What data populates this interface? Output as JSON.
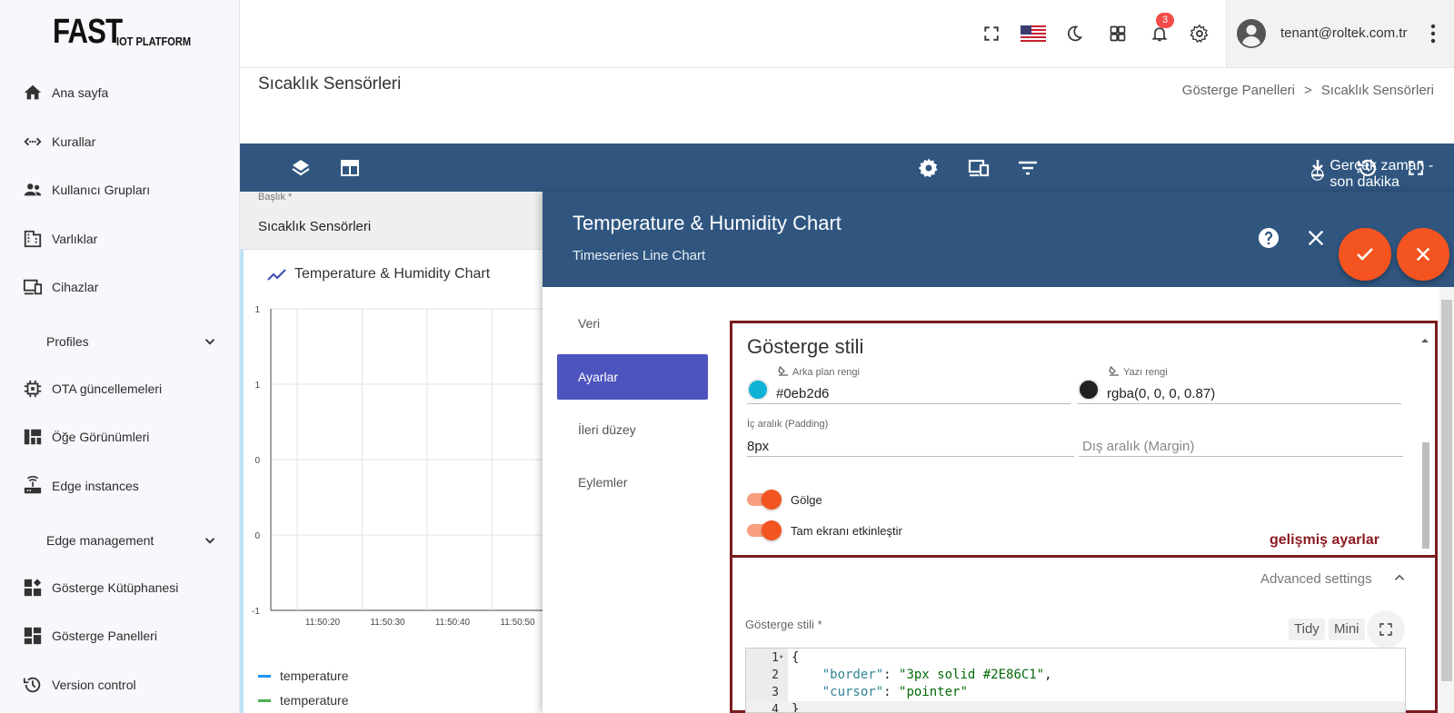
{
  "logo": {
    "main": "FAST",
    "sub": "IOT PLATFORM"
  },
  "sidebar": {
    "items": [
      {
        "label": "Ana sayfa",
        "icon": "home-icon"
      },
      {
        "label": "Kurallar",
        "icon": "rule-chain-icon"
      },
      {
        "label": "Kullanıcı Grupları",
        "icon": "users-icon"
      },
      {
        "label": "Varlıklar",
        "icon": "asset-icon"
      },
      {
        "label": "Cihazlar",
        "icon": "devices-icon"
      },
      {
        "label": "Profiles",
        "icon": "chevron-down-icon",
        "group": true
      },
      {
        "label": "OTA güncellemeleri",
        "icon": "chip-icon"
      },
      {
        "label": "Öğe Görünümleri",
        "icon": "widgets-icon"
      },
      {
        "label": "Edge instances",
        "icon": "router-icon"
      },
      {
        "label": "Edge management",
        "icon": "chevron-down-icon",
        "group": true
      },
      {
        "label": "Gösterge Kütüphanesi",
        "icon": "widget-library-icon"
      },
      {
        "label": "Gösterge Panelleri",
        "icon": "dashboard-icon"
      },
      {
        "label": "Version control",
        "icon": "history-icon"
      }
    ]
  },
  "topbar": {
    "notification_count": "3",
    "user_email": "tenant@roltek.com.tr"
  },
  "page": {
    "title": "Sıcaklık Sensörleri",
    "breadcrumb": [
      "Gösterge Panelleri",
      ">",
      "Sıcaklık Sensörleri"
    ]
  },
  "dashboard_toolbar": {
    "timewindow": "Gerçek zaman - son dakika"
  },
  "title_field": {
    "label": "Başlık *",
    "value": "Sıcaklık Sensörleri"
  },
  "widget": {
    "title": "Temperature & Humidity Chart",
    "legend": [
      {
        "label": "temperature",
        "color": "#2196f3"
      },
      {
        "label": "temperature",
        "color": "#4caf50"
      }
    ]
  },
  "chart_data": {
    "type": "line",
    "y_tick_labels": [
      "1",
      "1",
      "0",
      "0",
      "-1"
    ],
    "x_tick_labels": [
      "11:50:20",
      "11:50:30",
      "11:50:40",
      "11:50:50"
    ],
    "series": []
  },
  "dialog": {
    "title": "Temperature & Humidity Chart",
    "subtitle": "Timeseries Line Chart",
    "tabs": [
      "Veri",
      "Ayarlar",
      "İleri düzey",
      "Eylemler"
    ],
    "active_tab": "Ayarlar",
    "section_title": "Gösterge stili",
    "background_color": {
      "label": "Arka plan rengi",
      "value": "#0eb2d6",
      "swatch": "#0eb2d6"
    },
    "text_color": {
      "label": "Yazı rengi",
      "value": "rgba(0, 0, 0, 0.87)",
      "swatch": "#212121"
    },
    "padding": {
      "label": "İç aralık (Padding)",
      "value": "8px"
    },
    "margin": {
      "placeholder": "Dış aralık (Margin)"
    },
    "shadow_label": "Gölge",
    "fullscreen_label": "Tam ekranı etkinleştir",
    "annotation": "gelişmiş ayarlar",
    "advanced_label": "Advanced settings",
    "css_label": "Gösterge stili *",
    "tidy": "Tidy",
    "mini": "Mini",
    "code_lines": [
      {
        "n": "1",
        "text": "{"
      },
      {
        "n": "2",
        "key": "\"border\"",
        "val": "\"3px solid #2E86C1\"",
        "trail": ","
      },
      {
        "n": "3",
        "key": "\"cursor\"",
        "val": "\"pointer\"",
        "trail": ""
      },
      {
        "n": "4",
        "text": "}"
      }
    ]
  },
  "colors": {
    "primary": "#305680",
    "accent": "#f4541f",
    "active_tab": "#4d54bd",
    "annotation": "#7a1b20"
  }
}
